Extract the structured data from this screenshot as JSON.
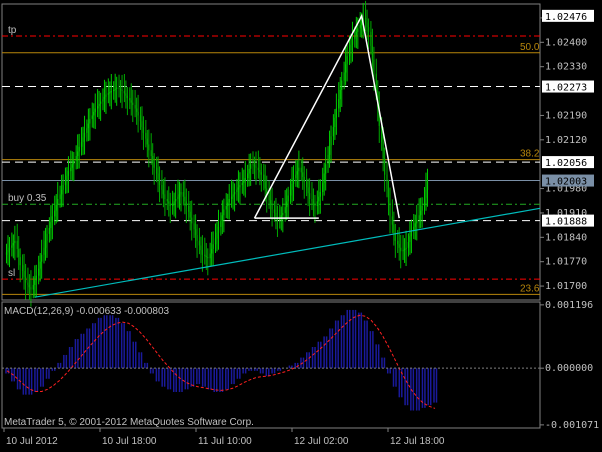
{
  "colors": {
    "background": "#000000",
    "bull_candle": "#00cc00",
    "bear_candle": "#00aa00",
    "grid": "#3a3a3a",
    "text": "#c0c0c0",
    "fib": "#b8860b",
    "tp_sl": "#ff0000",
    "buy_line": "#22aa22",
    "trendline": "#00bcbc",
    "triangle": "#ffffff",
    "macd_hist": "#1a1a9c",
    "macd_signal": "#ff2020",
    "price_tag_bg": "#ffffff",
    "price_tag_text": "#000000",
    "current_tag_bg": "#7a8fa6"
  },
  "chart_data": [
    {
      "type": "candlestick",
      "panel": "price",
      "y_ticks": [
        "1.02470",
        "1.02400",
        "1.02330",
        "1.02190",
        "1.02120",
        "1.01980",
        "1.01910",
        "1.01840",
        "1.01770",
        "1.01700"
      ],
      "ylim": [
        1.0166,
        1.0251
      ],
      "x_ticks": [
        "10 Jul 2012",
        "10 Jul 18:00",
        "11 Jul 10:00",
        "12 Jul 02:00",
        "12 Jul 18:00"
      ],
      "close_series": [
        1.0181,
        1.0183,
        1.0176,
        1.0171,
        1.0169,
        1.0173,
        1.0179,
        1.0185,
        1.019,
        1.0195,
        1.0199,
        1.0203,
        1.0206,
        1.021,
        1.0214,
        1.0218,
        1.0221,
        1.0223,
        1.0225,
        1.0226,
        1.0227,
        1.0226,
        1.0224,
        1.0222,
        1.0219,
        1.0214,
        1.0209,
        1.0204,
        1.0199,
        1.0195,
        1.0193,
        1.0195,
        1.0197,
        1.0193,
        1.0188,
        1.0183,
        1.0179,
        1.0178,
        1.0182,
        1.0187,
        1.0192,
        1.0195,
        1.0197,
        1.0199,
        1.0201,
        1.0205,
        1.0204,
        1.0202,
        1.0196,
        1.0192,
        1.0189,
        1.0191,
        1.0196,
        1.0201,
        1.0204,
        1.02,
        1.0195,
        1.0193,
        1.0197,
        1.0205,
        1.0213,
        1.0221,
        1.0229,
        1.0236,
        1.0241,
        1.0244,
        1.0247,
        1.0243,
        1.0231,
        1.0216,
        1.0202,
        1.019,
        1.0183,
        1.018,
        1.0181,
        1.0186,
        1.0189,
        1.0193,
        1.02
      ],
      "horizontal_levels": [
        {
          "name": "tp",
          "label": "tp",
          "price": 1.02418,
          "style": "dash-dot",
          "color_key": "tp_sl"
        },
        {
          "name": "fib-50",
          "label": "50.0",
          "price": 1.0237,
          "style": "solid",
          "color_key": "fib"
        },
        {
          "name": "level-1.02273",
          "label": "",
          "price": 1.02273,
          "style": "dashed",
          "color_key": "triangle"
        },
        {
          "name": "fib-38.2",
          "label": "38.2",
          "price": 1.02063,
          "style": "solid",
          "color_key": "fib"
        },
        {
          "name": "level-1.02056",
          "label": "",
          "price": 1.02056,
          "style": "dashed",
          "color_key": "triangle"
        },
        {
          "name": "current",
          "label": "",
          "price": 1.02003,
          "style": "solid",
          "color_key": "current_tag_bg"
        },
        {
          "name": "buy",
          "label": "buy 0.35",
          "price": 1.01935,
          "style": "dash-dot",
          "color_key": "buy_line"
        },
        {
          "name": "level-1.01888",
          "label": "",
          "price": 1.01888,
          "style": "dashed",
          "color_key": "triangle"
        },
        {
          "name": "sl",
          "label": "sl",
          "price": 1.0172,
          "style": "dash-dot",
          "color_key": "tp_sl"
        },
        {
          "name": "fib-23.6",
          "label": "23.6",
          "price": 1.01676,
          "style": "solid",
          "color_key": "fib"
        }
      ],
      "price_tags": [
        {
          "name": "tag-1.02476",
          "text": "1.02476",
          "price": 1.02476,
          "style": "white"
        },
        {
          "name": "tag-1.02273",
          "text": "1.02273",
          "price": 1.02273,
          "style": "white"
        },
        {
          "name": "tag-1.02056",
          "text": "1.02056",
          "price": 1.02056,
          "style": "white"
        },
        {
          "name": "tag-1.02003",
          "text": "1.02003",
          "price": 1.02003,
          "style": "current"
        },
        {
          "name": "tag-1.01888",
          "text": "1.01888",
          "price": 1.01888,
          "style": "white"
        }
      ],
      "triangle_points": [
        {
          "time_index": 46,
          "price": 1.01895
        },
        {
          "time_index": 66,
          "price": 1.02476
        },
        {
          "time_index": 73,
          "price": 1.01895
        }
      ],
      "trendline": [
        {
          "time_index": 5,
          "price": 1.01668
        },
        {
          "time_index": 87,
          "price": 1.0189
        }
      ],
      "triangle_base_end": {
        "time_index": 58,
        "price": 1.01895
      }
    },
    {
      "type": "macd",
      "panel": "indicator",
      "title": "MACD(12,26,9) -0.000633 -0.000803",
      "y_ticks": [
        "0.001196",
        "0.000000",
        "-0.001071"
      ],
      "ylim": [
        -0.00113,
        0.00125
      ],
      "histogram": [
        -0.0001,
        -0.00025,
        -0.0004,
        -0.0005,
        -0.0005,
        -0.00045,
        -0.00035,
        -0.0002,
        -5e-05,
        0.0001,
        0.00025,
        0.0004,
        0.00055,
        0.00065,
        0.00075,
        0.00085,
        0.00095,
        0.001,
        0.001,
        0.00095,
        0.00085,
        0.0007,
        0.0005,
        0.0003,
        0.0001,
        -0.0001,
        -0.00025,
        -0.00035,
        -0.0004,
        -0.00045,
        -0.00045,
        -0.0004,
        -0.00035,
        -0.0003,
        -0.00035,
        -0.0004,
        -0.00045,
        -0.00045,
        -0.0004,
        -0.0003,
        -0.0002,
        -0.0001,
        -5e-05,
        -5e-05,
        -0.0001,
        -0.00015,
        -0.0001,
        -5e-05,
        0.0,
        5e-05,
        0.0001,
        0.0002,
        0.0003,
        0.0004,
        0.0005,
        0.0006,
        0.00075,
        0.0009,
        0.001,
        0.0011,
        0.0011,
        0.00105,
        0.0009,
        0.0007,
        0.00045,
        0.0002,
        -0.0001,
        -0.00035,
        -0.00055,
        -0.0007,
        -0.0008,
        -0.0008,
        -0.00075,
        -0.0007,
        -0.00065
      ],
      "signal": [
        -5e-05,
        -0.00012,
        -0.00022,
        -0.00032,
        -0.0004,
        -0.00044,
        -0.00044,
        -0.0004,
        -0.00033,
        -0.00024,
        -0.00013,
        -1e-05,
        0.00012,
        0.00025,
        0.00038,
        0.0005,
        0.00062,
        0.00072,
        0.0008,
        0.00085,
        0.00087,
        0.00085,
        0.00078,
        0.00068,
        0.00056,
        0.00042,
        0.00028,
        0.00014,
        2e-05,
        -0.0001,
        -0.0002,
        -0.00027,
        -0.00032,
        -0.00035,
        -0.00037,
        -0.00039,
        -0.00041,
        -0.00042,
        -0.00041,
        -0.00038,
        -0.00033,
        -0.00027,
        -0.00022,
        -0.00018,
        -0.00016,
        -0.00015,
        -0.00013,
        -0.0001,
        -7e-05,
        -3e-05,
        2e-05,
        9e-05,
        0.00017,
        0.00026,
        0.00035,
        0.00045,
        0.00056,
        0.00067,
        0.00078,
        0.00088,
        0.00096,
        0.001,
        0.00098,
        0.0009,
        0.00077,
        0.0006,
        0.0004,
        0.00018,
        -4e-05,
        -0.00024,
        -0.00042,
        -0.00056,
        -0.00066,
        -0.00072,
        -0.00076
      ]
    }
  ],
  "copyright": "MetaTrader 5, © 2001-2012 MetaQuotes Software Corp."
}
